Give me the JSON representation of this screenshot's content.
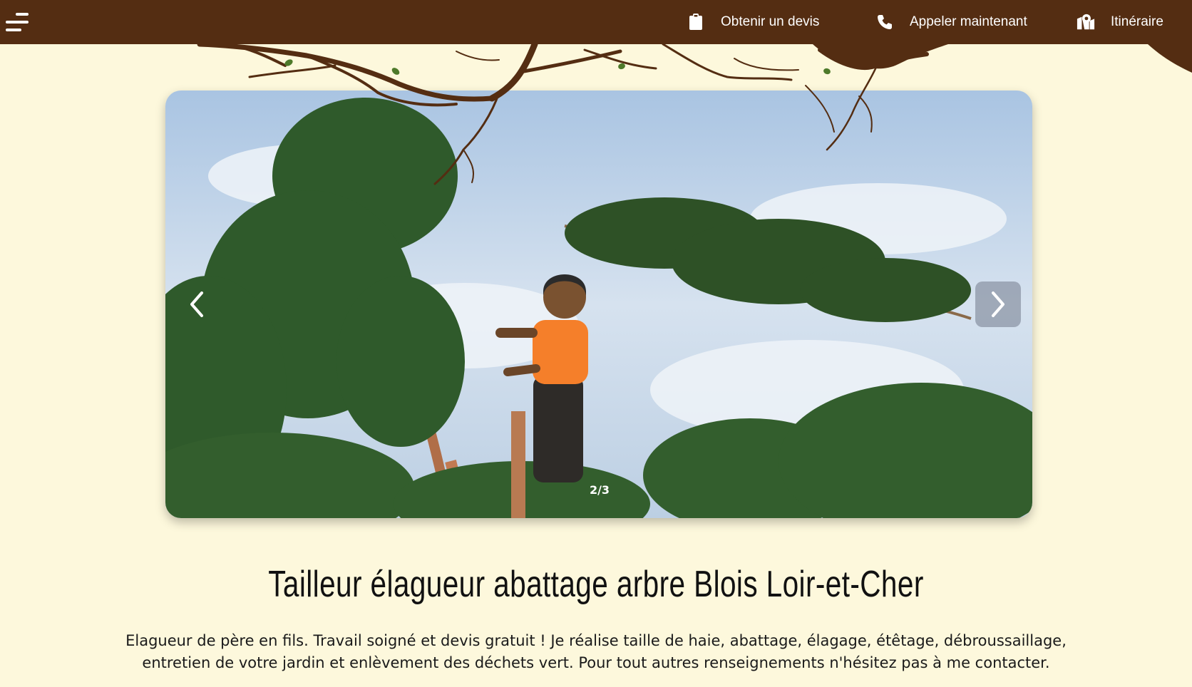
{
  "header": {
    "menu_icon": "hamburger-menu-icon",
    "nav": [
      {
        "label": "Obtenir un devis",
        "icon": "clipboard-icon"
      },
      {
        "label": "Appeler maintenant",
        "icon": "phone-icon"
      },
      {
        "label": "Itinéraire",
        "icon": "map-marker-icon"
      }
    ]
  },
  "slider": {
    "counter": "2/3",
    "prev_icon": "chevron-left-icon",
    "next_icon": "chevron-right-icon",
    "current_slide": 2,
    "total_slides": 3
  },
  "main": {
    "title": "Tailleur élagueur abattage arbre Blois Loir-et-Cher",
    "intro": "Elagueur de père en fils. Travail soigné et devis gratuit ! Je réalise taille de haie, abattage, élagage, étêtage, débroussaillage, entretien de votre jardin et enlèvement des déchets vert. Pour tout autres renseignements n'hésitez pas à me contacter."
  },
  "colors": {
    "header_bg": "#542d12",
    "page_bg": "#fdf8dc",
    "branch": "#542d12",
    "leaf": "#4e7a2a"
  }
}
